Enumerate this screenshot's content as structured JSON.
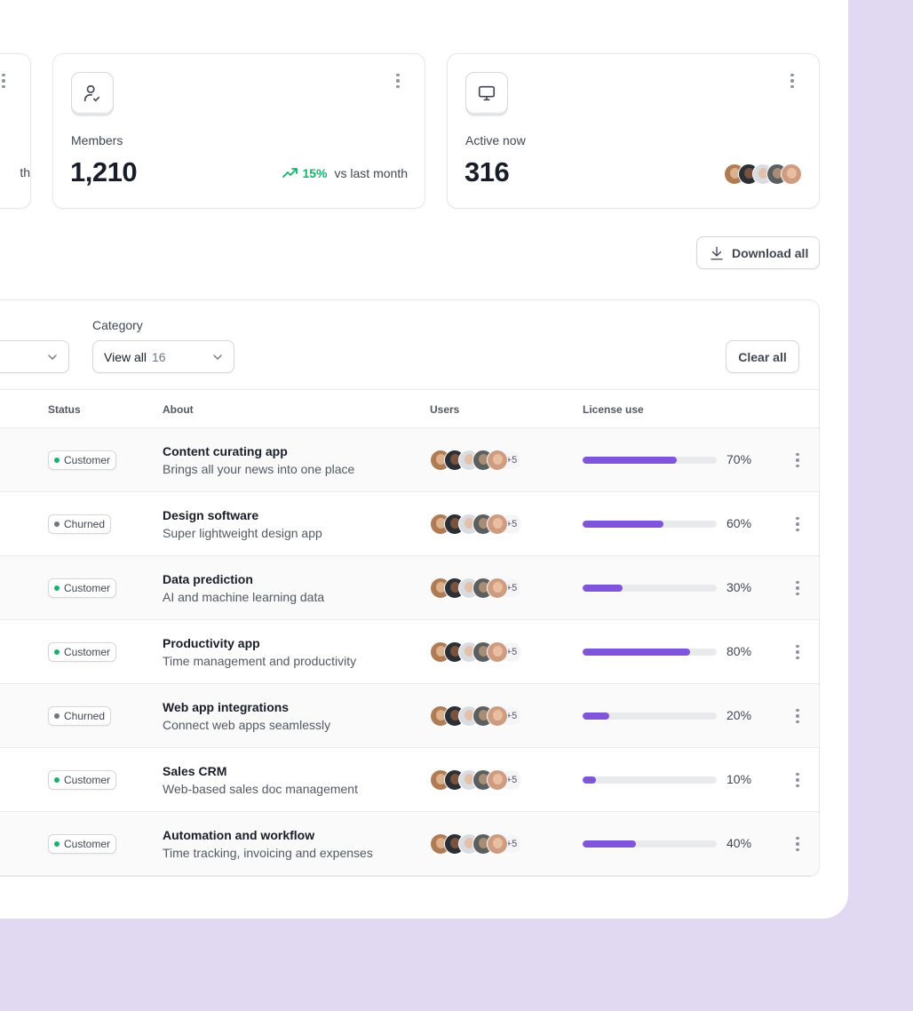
{
  "cards": [
    {
      "partial_text": "th"
    },
    {
      "icon": "user-check-icon",
      "label": "Members",
      "value": "1,210",
      "trend_pct": "15%",
      "trend_text": "vs last month",
      "trend_color": "#17b26a"
    },
    {
      "icon": "monitor-icon",
      "label": "Active now",
      "value": "316"
    }
  ],
  "download_label": "Download all",
  "filters": {
    "category_label": "Category",
    "category_value": "View all",
    "category_count": "16",
    "clear_label": "Clear all"
  },
  "table": {
    "headers": {
      "status": "Status",
      "about": "About",
      "users": "Users",
      "license": "License use"
    },
    "extra_users": "+5",
    "rows": [
      {
        "status": "Customer",
        "title": "Content curating app",
        "desc": "Brings all your news into one place",
        "license": 70,
        "license_label": "70%"
      },
      {
        "status": "Churned",
        "title": "Design software",
        "desc": "Super lightweight design app",
        "license": 60,
        "license_label": "60%"
      },
      {
        "status": "Customer",
        "title": "Data prediction",
        "desc": "AI and machine learning data",
        "license": 30,
        "license_label": "30%"
      },
      {
        "status": "Customer",
        "title": "Productivity app",
        "desc": "Time management and productivity",
        "license": 80,
        "license_label": "80%"
      },
      {
        "status": "Churned",
        "title": "Web app integrations",
        "desc": "Connect web apps seamlessly",
        "license": 20,
        "license_label": "20%"
      },
      {
        "status": "Customer",
        "title": "Sales CRM",
        "desc": "Web-based sales doc management",
        "license": 10,
        "license_label": "10%"
      },
      {
        "status": "Customer",
        "title": "Automation and workflow",
        "desc": "Time tracking, invoicing and expenses",
        "license": 40,
        "license_label": "40%"
      }
    ]
  },
  "colors": {
    "accent": "#7f56d9",
    "customer_dot": "#17b26a",
    "churned_dot": "#717680",
    "background": "#e1d8f2"
  }
}
